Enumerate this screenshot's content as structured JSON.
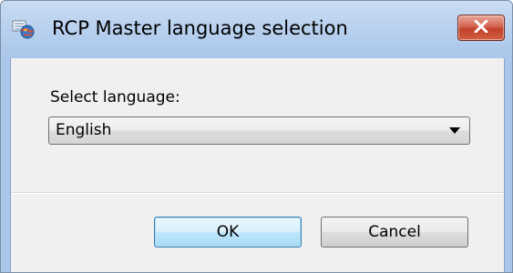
{
  "window": {
    "title": "RCP Master language selection",
    "app_icon": "language-app-icon",
    "close_icon": "close-icon"
  },
  "form": {
    "select_label": "Select language:",
    "language_value": "English",
    "dropdown_icon": "chevron-down-icon"
  },
  "buttons": {
    "ok_label": "OK",
    "cancel_label": "Cancel"
  },
  "colors": {
    "title_bar": "#b9d1ee",
    "close_button": "#c9503a",
    "client_background": "#f0f0f0",
    "default_button_border": "#3c7fb1"
  }
}
